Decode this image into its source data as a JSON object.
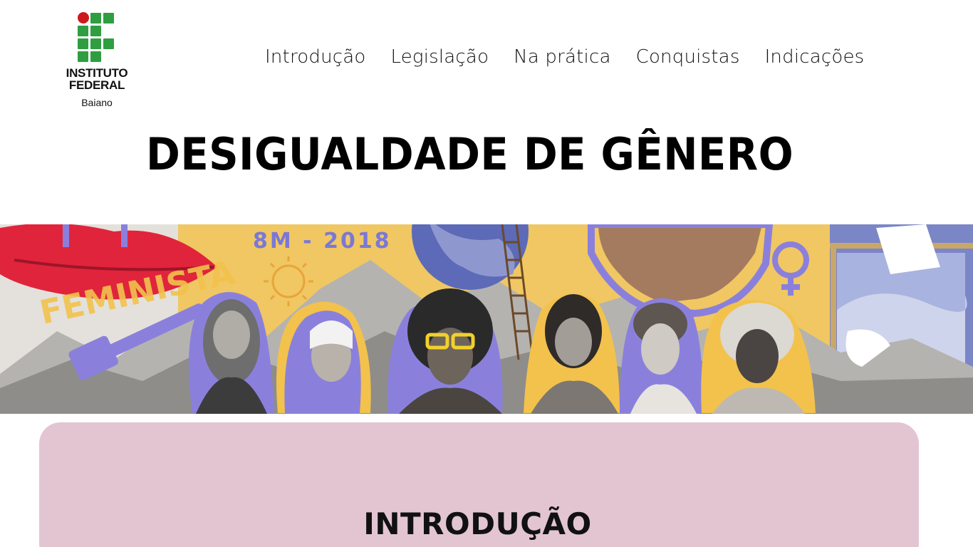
{
  "logo": {
    "line1": "INSTITUTO",
    "line2": "FEDERAL",
    "line3": "Baiano",
    "colors": {
      "green": "#2f9e41",
      "red": "#cd191e"
    }
  },
  "nav": {
    "items": [
      {
        "label": "Introdução"
      },
      {
        "label": "Legislação"
      },
      {
        "label": "Na prática"
      },
      {
        "label": "Conquistas"
      },
      {
        "label": "Indicações"
      }
    ]
  },
  "page": {
    "title": "DESIGUALDADE DE GÊNERO"
  },
  "banner": {
    "caption_text": "8M - 2018",
    "side_text": "FEMINISTA",
    "colors": {
      "purple": "#8a80dc",
      "yellow": "#f2c24c",
      "lips": "#e0243c",
      "sky": "#7a86c6"
    }
  },
  "intro": {
    "title": "INTRODUÇÃO",
    "background": "#e3c5d2"
  }
}
